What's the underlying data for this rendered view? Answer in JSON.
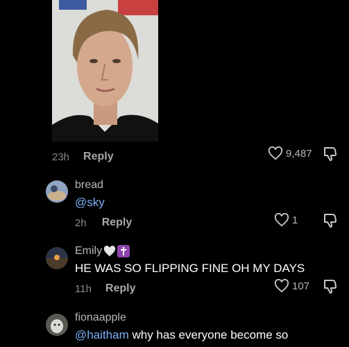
{
  "top_comment": {
    "time": "23h",
    "reply_label": "Reply",
    "likes": "9,487"
  },
  "comments": [
    {
      "username": "bread",
      "mention": "@sky",
      "text": "",
      "time": "2h",
      "reply_label": "Reply",
      "likes": "1"
    },
    {
      "username": "Emily",
      "badges": [
        "white-heart-icon",
        "latin-cross-icon"
      ],
      "text": "HE WAS SO FLIPPING FINE OH MY DAYS",
      "time": "11h",
      "reply_label": "Reply",
      "likes": "107"
    },
    {
      "username": "fionaapple",
      "mention": "@haitham",
      "text": " why has everyone become so"
    }
  ],
  "colors": {
    "background": "#000000",
    "mention": "#7aaef5",
    "username": "#b9b9b9",
    "meta": "#8a8a8a",
    "badge_purple": "#8e44ad"
  }
}
